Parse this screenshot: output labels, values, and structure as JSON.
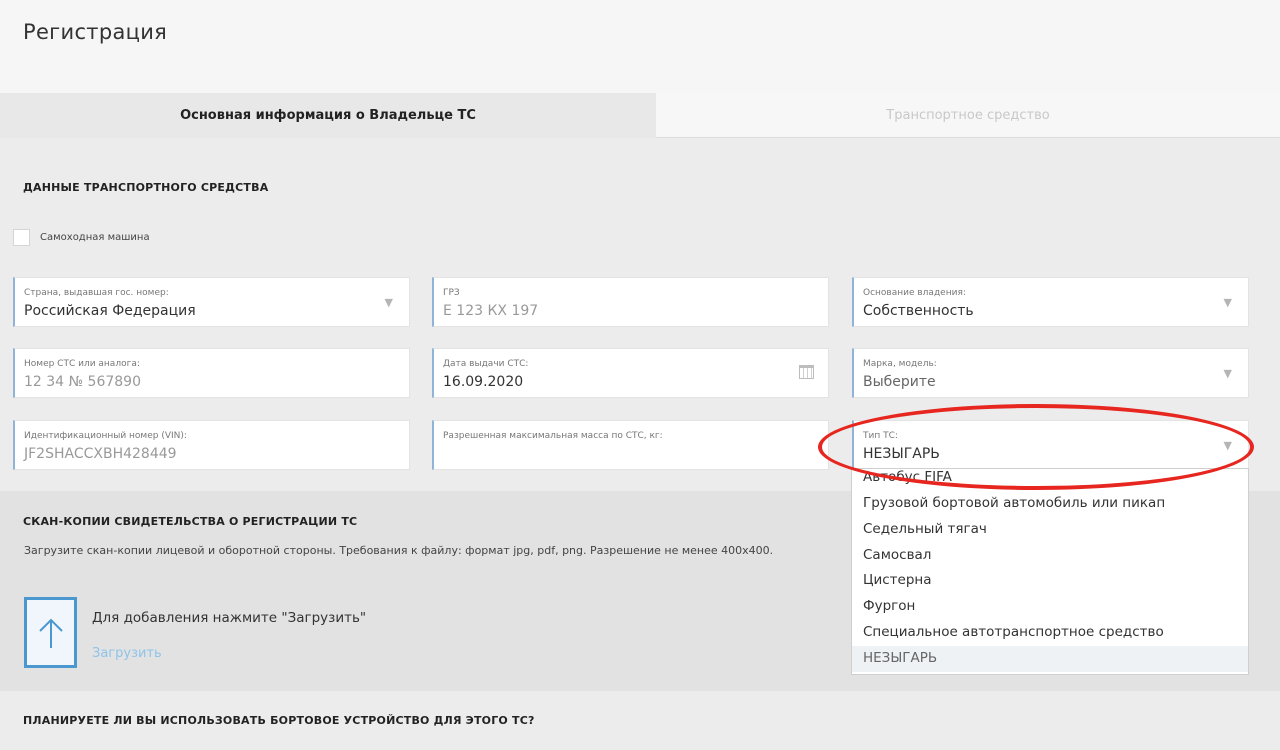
{
  "page": {
    "title": "Регистрация"
  },
  "tabs": [
    {
      "label": "Основная информация о Владельце ТС",
      "active": true
    },
    {
      "label": "Транспортное средство",
      "active": false
    }
  ],
  "vehicle_section": {
    "heading": "ДАННЫЕ ТРАНСПОРТНОГО СРЕДСТВА",
    "self_propelled": {
      "label": "Самоходная машина",
      "checked": false
    }
  },
  "fields": {
    "country": {
      "label": "Страна, выдавшая гос. номер:",
      "value": "Российская Федерация"
    },
    "plate": {
      "label": "ГРЗ",
      "value": "Е 123 КХ 197"
    },
    "ownership": {
      "label": "Основание владения:",
      "value": "Собственность"
    },
    "sts_number": {
      "label": "Номер СТС или аналога:",
      "value": "12 34 № 567890"
    },
    "sts_date": {
      "label": "Дата выдачи СТС:",
      "value": "16.09.2020"
    },
    "make_model": {
      "label": "Марка, модель:",
      "value": "Выберите"
    },
    "vin": {
      "label": "Идентификационный номер (VIN):",
      "value": "JF2SHACCXBH428449"
    },
    "max_mass": {
      "label": "Разрешенная максимальная масса по СТС, кг:",
      "value": ""
    },
    "vehicle_type": {
      "label": "Тип ТС:",
      "value": "НЕЗЫГАРЬ"
    }
  },
  "vehicle_type_options": [
    "Автобус FIFA",
    "Грузовой бортовой автомобиль или пикап",
    "Седельный тягач",
    "Самосвал",
    "Цистерна",
    "Фургон",
    "Специальное автотранспортное средство",
    "НЕЗЫГАРЬ"
  ],
  "scan_section": {
    "heading": "СКАН-КОПИИ СВИДЕТЕЛЬСТВА О РЕГИСТРАЦИИ ТС",
    "description": "Загрузите скан-копии лицевой и оборотной стороны. Требования к файлу: формат jpg, pdf, png. Разрешение не менее 400х400.",
    "upload_hint": "Для добавления нажмите \"Загрузить\"",
    "upload_link": "Загрузить"
  },
  "onboard_section": {
    "heading": "ПЛАНИРУЕТЕ ЛИ ВЫ ИСПОЛЬЗОВАТЬ БОРТОВОЕ УСТРОЙСТВО ДЛЯ ЭТОГО ТС?"
  },
  "colors": {
    "accent": "#4a98cf",
    "highlight": "#e6261f"
  }
}
